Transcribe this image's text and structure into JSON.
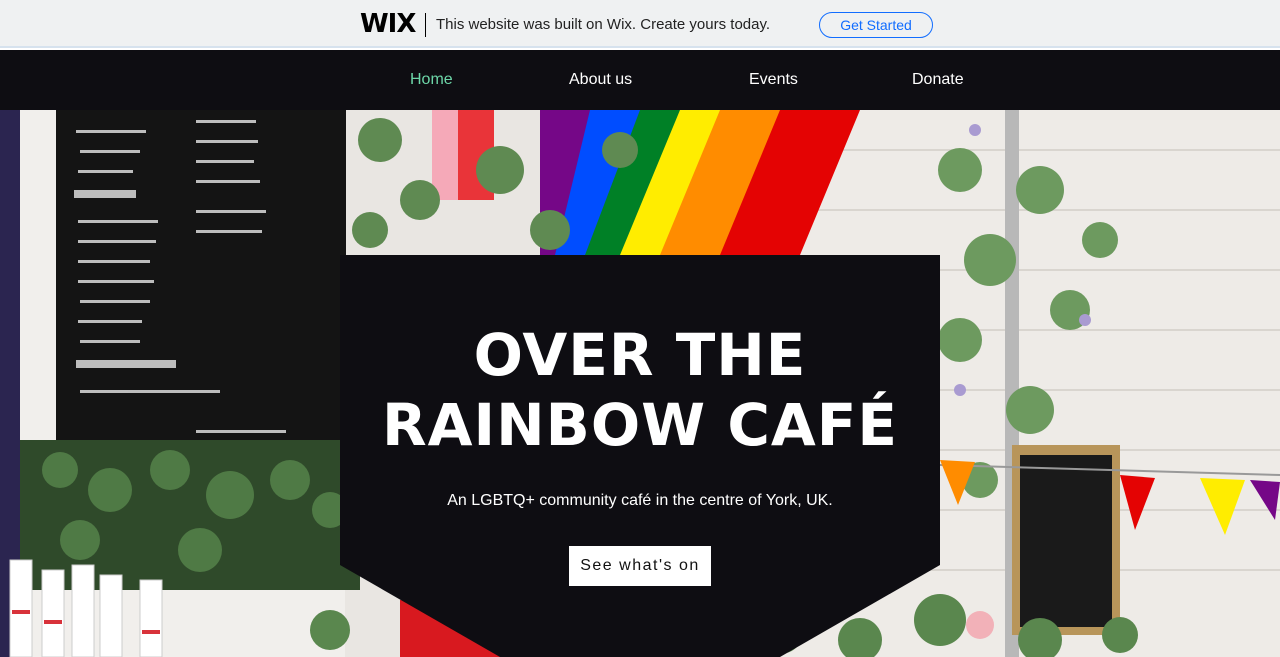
{
  "wix_banner": {
    "logo": "WIX",
    "message": "This website was built on Wix. Create yours today.",
    "cta": "Get Started"
  },
  "nav": {
    "items": [
      {
        "label": "Home",
        "active": true
      },
      {
        "label": "About us",
        "active": false
      },
      {
        "label": "Events",
        "active": false
      },
      {
        "label": "Donate",
        "active": false
      }
    ]
  },
  "hero": {
    "title_line1": "Over the",
    "title_line2": "Rainbow Café",
    "subtitle": "An LGBTQ+ community café in the centre of York, UK.",
    "button": "See what's on"
  },
  "colors": {
    "nav_bg": "#0e0d12",
    "nav_active": "#6dd6a8",
    "wix_accent": "#116dff",
    "panel_bg": "#0e0d12"
  }
}
